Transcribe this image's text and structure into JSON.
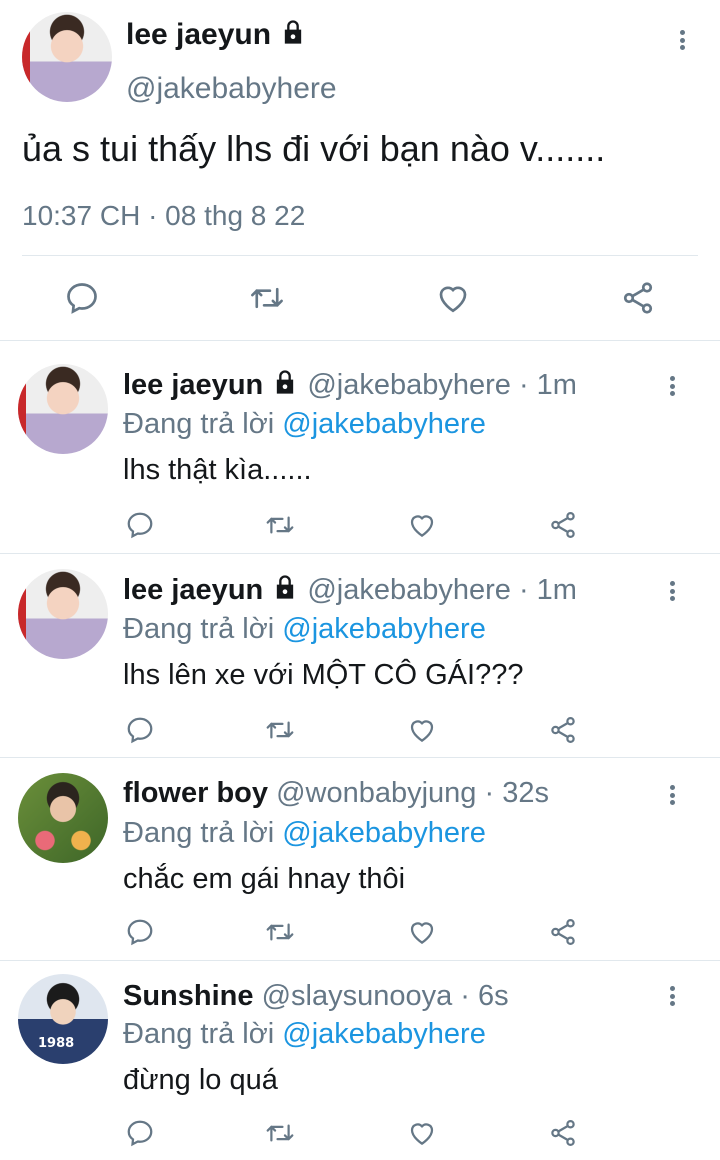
{
  "main_tweet": {
    "display_name": "lee jaeyun",
    "handle": "@jakebabyhere",
    "text": "ủa s tui thấy lhs đi với bạn nào v.......",
    "timestamp": "10:37 CH · 08 thg 8 22",
    "actions": [
      "reply-icon",
      "retweet-icon",
      "like-icon",
      "share-icon"
    ]
  },
  "replies": [
    {
      "display_name": "lee jaeyun",
      "handle": "@jakebabyhere",
      "time": "· 1m",
      "replying_label": "Đang trả lời",
      "replying_to": "@jakebabyhere",
      "text": "lhs thật kìa......",
      "locked": true
    },
    {
      "display_name": "lee jaeyun",
      "handle": "@jakebabyhere",
      "time": "· 1m",
      "replying_label": "Đang trả lời",
      "replying_to": "@jakebabyhere",
      "text": "lhs lên xe với MỘT CÔ GÁI???",
      "locked": true
    },
    {
      "display_name": "flower boy",
      "handle": "@wonbabyjung",
      "time": "· 32s",
      "replying_label": "Đang trả lời",
      "replying_to": "@jakebabyhere",
      "text": "chắc em gái hnay thôi",
      "locked": false
    },
    {
      "display_name": "Sunshine",
      "handle": "@slaysunooya",
      "time": "· 6s",
      "replying_label": "Đang trả lời",
      "replying_to": "@jakebabyhere",
      "text": "đừng lo quá",
      "locked": false
    }
  ],
  "colors": {
    "text": "#14171a",
    "muted": "#657786",
    "mention": "#1b95e0",
    "divider": "#e1e8ed"
  }
}
